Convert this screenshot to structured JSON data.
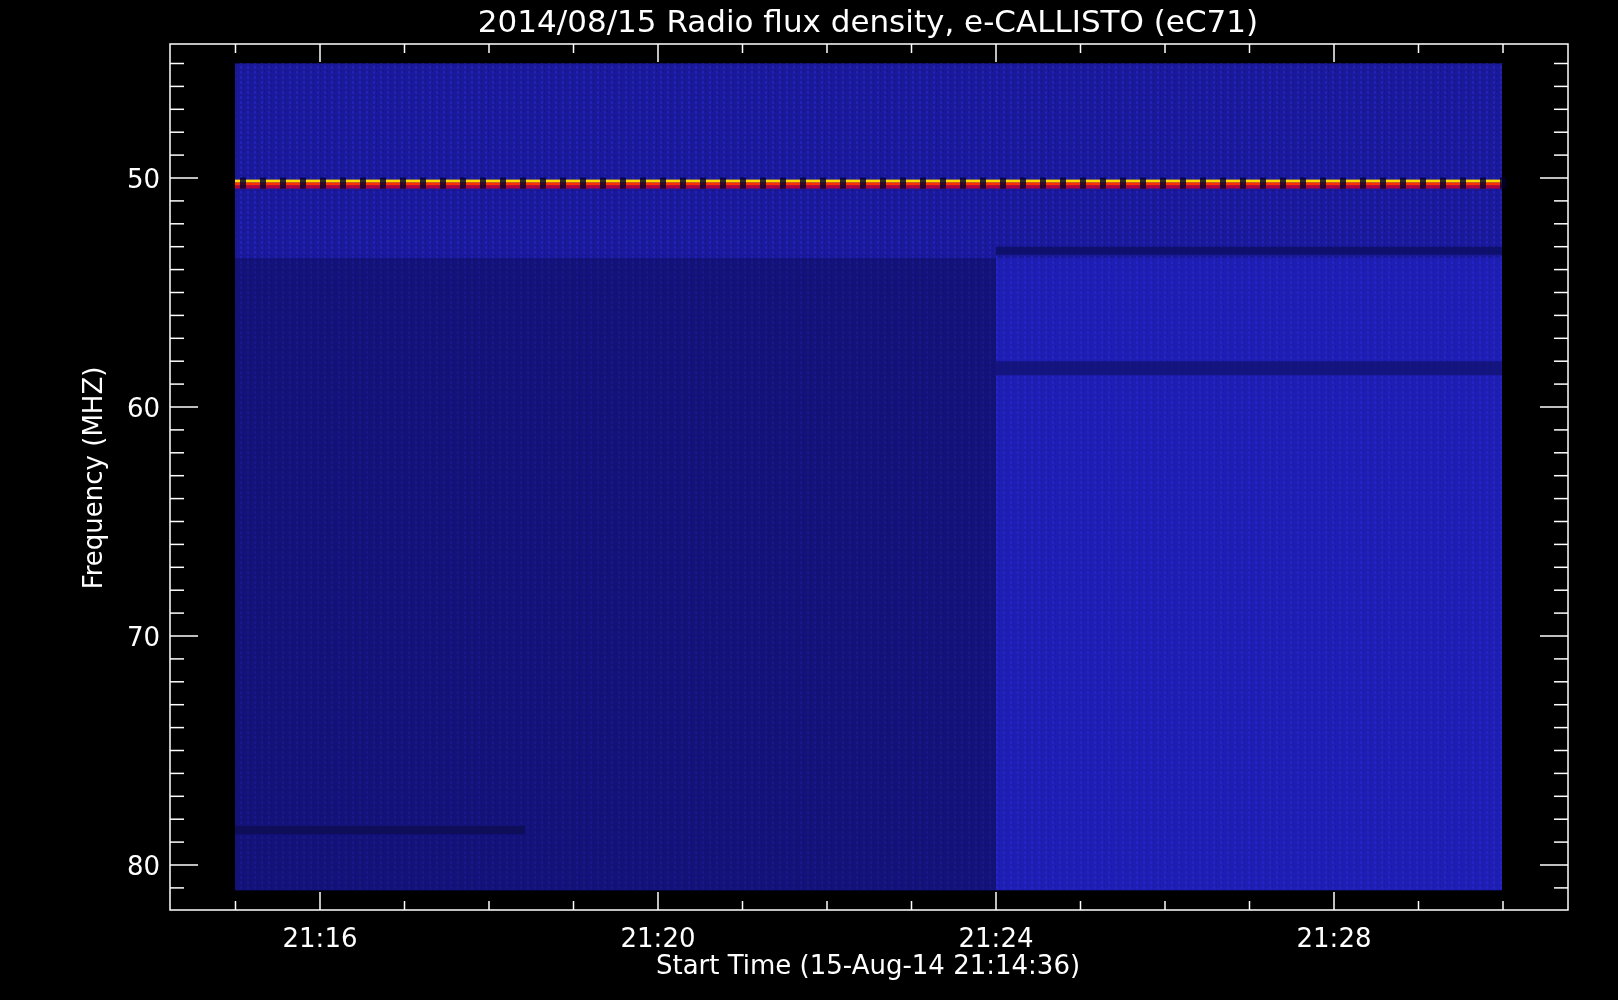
{
  "plot": {
    "title": "2014/08/15  Radio flux density, e-CALLISTO (eC71)",
    "xlabel": "Start Time (15-Aug-14 21:14:36)",
    "ylabel": "Frequency (MHZ)",
    "xtick_labels": [
      "21:16",
      "21:20",
      "21:24",
      "21:28"
    ],
    "ytick_labels": [
      "50",
      "60",
      "70",
      "80"
    ]
  }
}
